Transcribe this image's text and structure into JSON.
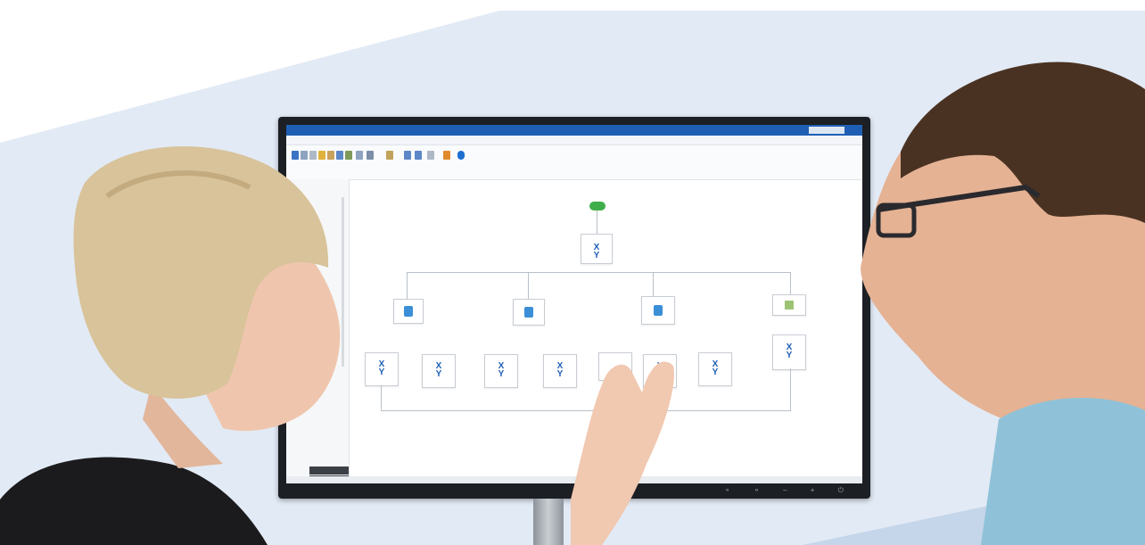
{
  "scene": {
    "description_free": true
  },
  "colors": {
    "background_panel": "#e4ecf6",
    "monitor_bezel": "#1c1f24",
    "titlebar": "#1e5fb4",
    "start_node": "#3fae49",
    "shirt_right": "#8fc2d8"
  },
  "icons": [
    "start-node-icon",
    "user-avatar-icon",
    "xy-variable-icon",
    "image-node-icon"
  ]
}
